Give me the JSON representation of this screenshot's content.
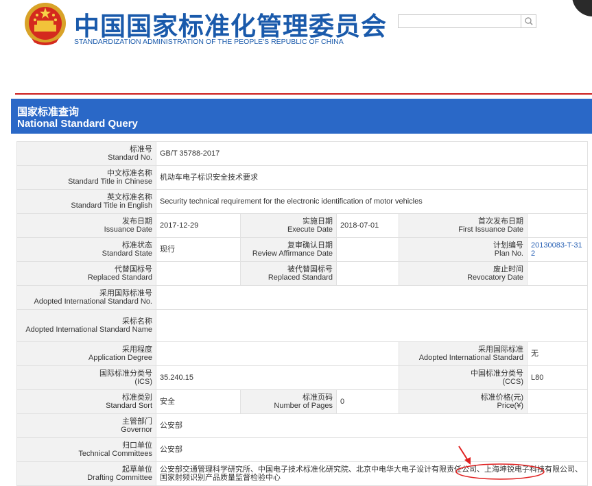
{
  "header": {
    "title_cn": "中国国家标准化管理委员会",
    "title_en": "STANDARDIZATION ADMINISTRATION OF THE PEOPLE'S REPUBLIC OF CHINA",
    "search": {
      "value": "",
      "placeholder": ""
    }
  },
  "query_header": {
    "title_cn": "国家标准查询",
    "title_en": "National Standard Query"
  },
  "fields": {
    "standard_no": {
      "cn": "标准号",
      "en": "Standard No.",
      "value": "GB/T 35788-2017"
    },
    "title_cn": {
      "cn": "中文标准名称",
      "en": "Standard Title in Chinese",
      "value": "机动车电子标识安全技术要求"
    },
    "title_en": {
      "cn": "英文标准名称",
      "en": "Standard Title in English",
      "value": "Security technical requirement for the electronic identification of motor vehicles"
    },
    "issuance_date": {
      "cn": "发布日期",
      "en": "Issuance Date",
      "value": "2017-12-29"
    },
    "execute_date": {
      "cn": "实施日期",
      "en": "Execute Date",
      "value": "2018-07-01"
    },
    "first_issuance_date": {
      "cn": "首次发布日期",
      "en": "First Issuance Date",
      "value": ""
    },
    "standard_state": {
      "cn": "标准状态",
      "en": "Standard State",
      "value": "现行"
    },
    "review_date": {
      "cn": "复审确认日期",
      "en": "Review Affirmance Date",
      "value": ""
    },
    "plan_no": {
      "cn": "计划编号",
      "en": "Plan No.",
      "value": "20130083-T-312"
    },
    "replaced_standard": {
      "cn": "代替国标号",
      "en": "Replaced Standard",
      "value": ""
    },
    "replaced_by": {
      "cn": "被代替国标号",
      "en": "Replaced Standard",
      "value": ""
    },
    "revocatory_date": {
      "cn": "废止时间",
      "en": "Revocatory Date",
      "value": ""
    },
    "adopted_intl_no": {
      "cn": "采用国际标准号",
      "en": "Adopted International Standard No.",
      "value": ""
    },
    "adopted_intl_name": {
      "cn": "采标名称",
      "en": "Adopted International Standard Name",
      "value": ""
    },
    "application_degree": {
      "cn": "采用程度",
      "en": "Application Degree",
      "value": ""
    },
    "adopted_intl_standard": {
      "cn": "采用国际标准",
      "en": "Adopted International Standard",
      "value": "无"
    },
    "ics": {
      "cn": "国际标准分类号",
      "en": "(ICS)",
      "value": "35.240.15"
    },
    "ccs": {
      "cn": "中国标准分类号",
      "en": "(CCS)",
      "value": "L80"
    },
    "standard_sort": {
      "cn": "标准类别",
      "en": "Standard Sort",
      "value": "安全"
    },
    "number_of_pages": {
      "cn": "标准页码",
      "en": "Number of Pages",
      "value": "0"
    },
    "price": {
      "cn": "标准价格(元)",
      "en": "Price(¥)",
      "value": ""
    },
    "governor": {
      "cn": "主管部门",
      "en": "Governor",
      "value": "公安部"
    },
    "technical_committees": {
      "cn": "归口单位",
      "en": "Technical Committees",
      "value": "公安部"
    },
    "drafting_committee": {
      "cn": "起草单位",
      "en": "Drafting Committee",
      "value_before": "公安部交通管理科学研究所、中国电子技术标准化研究院、北京中电华大电子设计有限责任公司、",
      "value_highlight": "上海坤锐电子科技有限公司",
      "value_after": "、国家射频识别产品质量监督检验中心"
    }
  },
  "colors": {
    "brand_blue": "#1a5aab",
    "header_bar": "#2a68c7",
    "rule_red": "#cc1a1a",
    "annotation_red": "#e02020",
    "link_blue": "#2a62b5"
  },
  "icons": {
    "emblem": "national-emblem-icon",
    "search": "search-icon",
    "arrow": "arrow-annotation-icon"
  }
}
